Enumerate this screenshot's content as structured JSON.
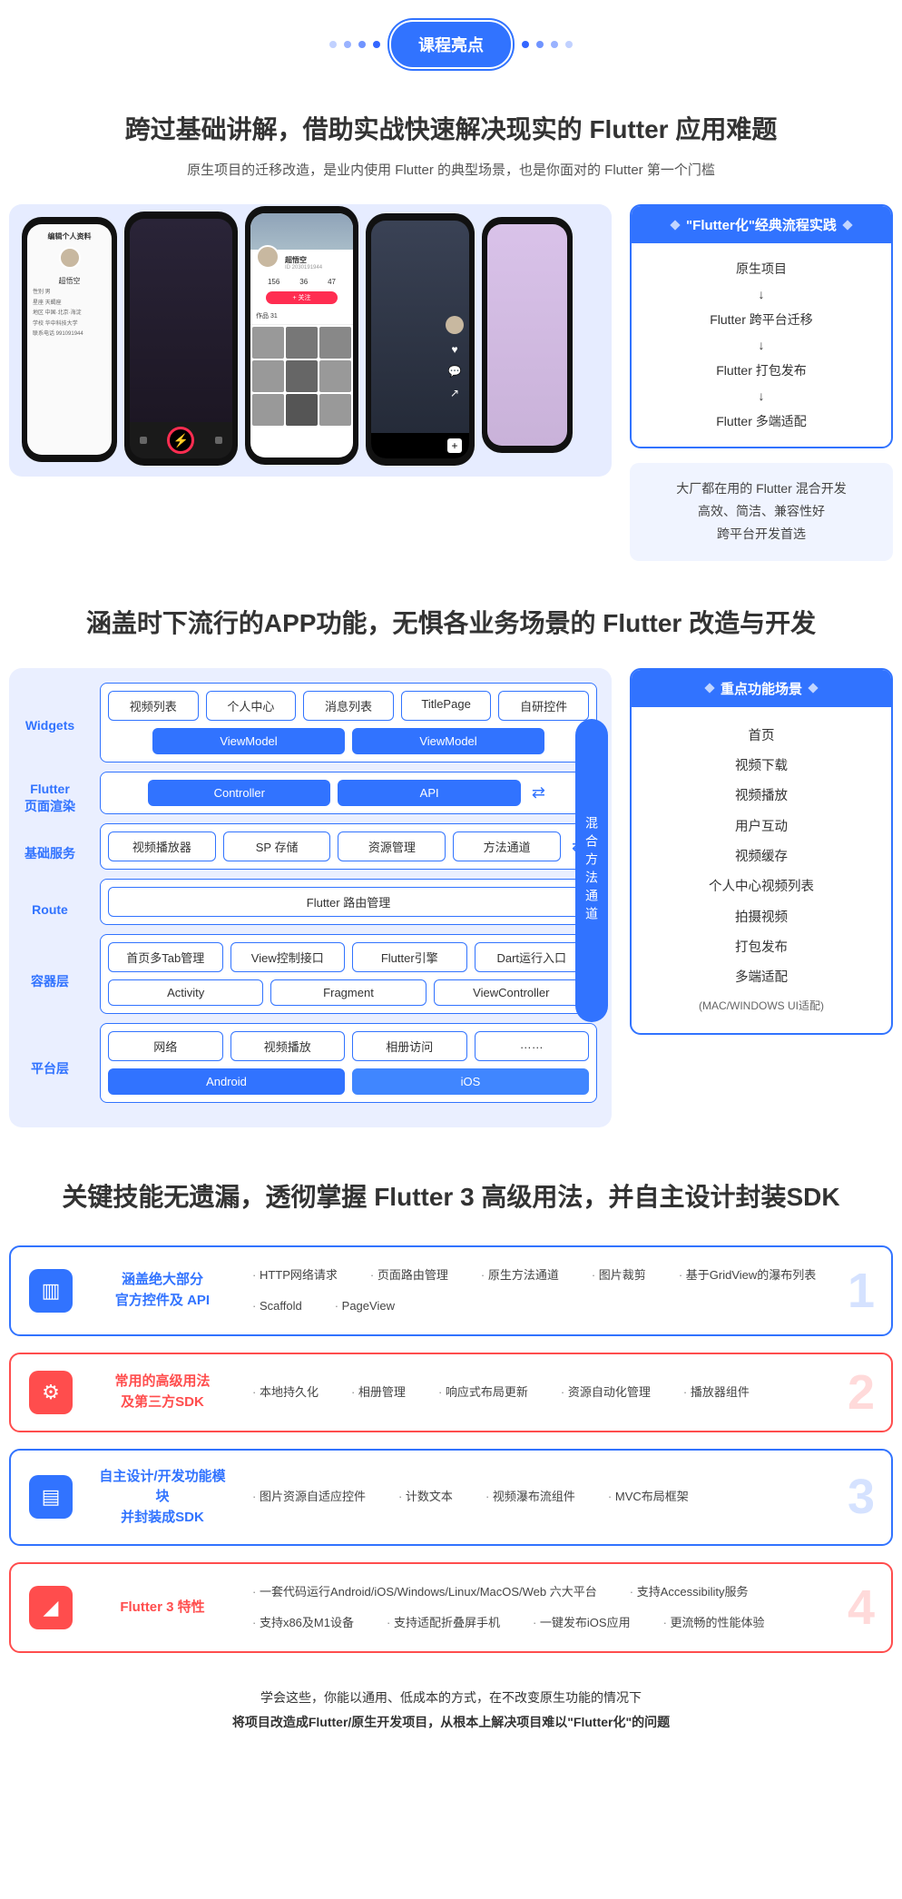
{
  "header": {
    "pill": "课程亮点"
  },
  "section1": {
    "title": "跨过基础讲解，借助实战快速解决现实的 Flutter 应用难题",
    "subtitle": "原生项目的迁移改造，是业内使用 Flutter 的典型场景，也是你面对的 Flutter 第一个门槛",
    "phone1": {
      "header": "编辑个人资料",
      "name": "超悟空",
      "rows": [
        "性别 男",
        "星座 天蝎座",
        "地区 中国·北京·海淀",
        "学校 华中科技大学",
        "联系电话 991091944"
      ]
    },
    "phone3": {
      "name": "超悟空",
      "id": "ID 2030191944",
      "stats": [
        "156",
        "36",
        "47"
      ],
      "follow": "+ 关注",
      "tab": "作品 31"
    },
    "flow_card": {
      "head": "\"Flutter化\"经典流程实践",
      "steps": [
        "原生项目",
        "↓",
        "Flutter 跨平台迁移",
        "↓",
        "Flutter 打包发布",
        "↓",
        "Flutter 多端适配"
      ]
    },
    "soft_card": [
      "大厂都在用的 Flutter 混合开发",
      "高效、简洁、兼容性好",
      "跨平台开发首选"
    ]
  },
  "section2": {
    "title": "涵盖时下流行的APP功能，无惧各业务场景的 Flutter 改造与开发",
    "arch": {
      "labels": [
        "Widgets",
        "Flutter\n页面渲染",
        "基础服务",
        "Route",
        "容器层",
        "平台层"
      ],
      "r1a": [
        "视频列表",
        "个人中心",
        "消息列表",
        "TitlePage",
        "自研控件"
      ],
      "r1b": [
        "ViewModel",
        "ViewModel"
      ],
      "r2": [
        "Controller",
        "API"
      ],
      "r3": [
        "视频播放器",
        "SP 存储",
        "资源管理",
        "方法通道"
      ],
      "r4": [
        "Flutter 路由管理"
      ],
      "r5a": [
        "首页多Tab管理",
        "View控制接口",
        "Flutter引擎",
        "Dart运行入口"
      ],
      "r5b": [
        "Activity",
        "Fragment",
        "ViewController"
      ],
      "r6a": [
        "网络",
        "视频播放",
        "相册访问",
        "……"
      ],
      "r6b": [
        "Android",
        "iOS"
      ],
      "hybrid": "混合方法通道"
    },
    "scenes": {
      "head": "重点功能场景",
      "items": [
        "首页",
        "视频下载",
        "视频播放",
        "用户互动",
        "视频缓存",
        "个人中心视频列表",
        "拍摄视频",
        "打包发布",
        "多端适配"
      ],
      "small": "(MAC/WINDOWS UI适配)"
    }
  },
  "section3": {
    "title": "关键技能无遗漏，透彻掌握 Flutter 3 高级用法，并自主设计封装SDK",
    "cards": [
      {
        "num": "1",
        "color": "blue",
        "title1": "涵盖绝大部分",
        "title2": "官方控件及 API",
        "items": [
          "HTTP网络请求",
          "页面路由管理",
          "原生方法通道",
          "图片裁剪",
          "基于GridView的瀑布列表",
          "Scaffold",
          "PageView"
        ]
      },
      {
        "num": "2",
        "color": "red",
        "title1": "常用的高级用法",
        "title2": "及第三方SDK",
        "items": [
          "本地持久化",
          "相册管理",
          "响应式布局更新",
          "资源自动化管理",
          "播放器组件"
        ]
      },
      {
        "num": "3",
        "color": "blue",
        "title1": "自主设计/开发功能模块",
        "title2": "并封装成SDK",
        "items": [
          "图片资源自适应控件",
          "计数文本",
          "视频瀑布流组件",
          "MVC布局框架"
        ]
      },
      {
        "num": "4",
        "color": "red",
        "title1": "Flutter 3 特性",
        "title2": "",
        "items": [
          "一套代码运行Android/iOS/Windows/Linux/MacOS/Web 六大平台",
          "支持Accessibility服务",
          "支持x86及M1设备",
          "支持适配折叠屏手机",
          "一键发布iOS应用",
          "更流畅的性能体验"
        ]
      }
    ],
    "footer1": "学会这些，你能以通用、低成本的方式，在不改变原生功能的情况下",
    "footer2": "将项目改造成Flutter/原生开发项目，从根本上解决项目难以\"Flutter化\"的问题"
  }
}
